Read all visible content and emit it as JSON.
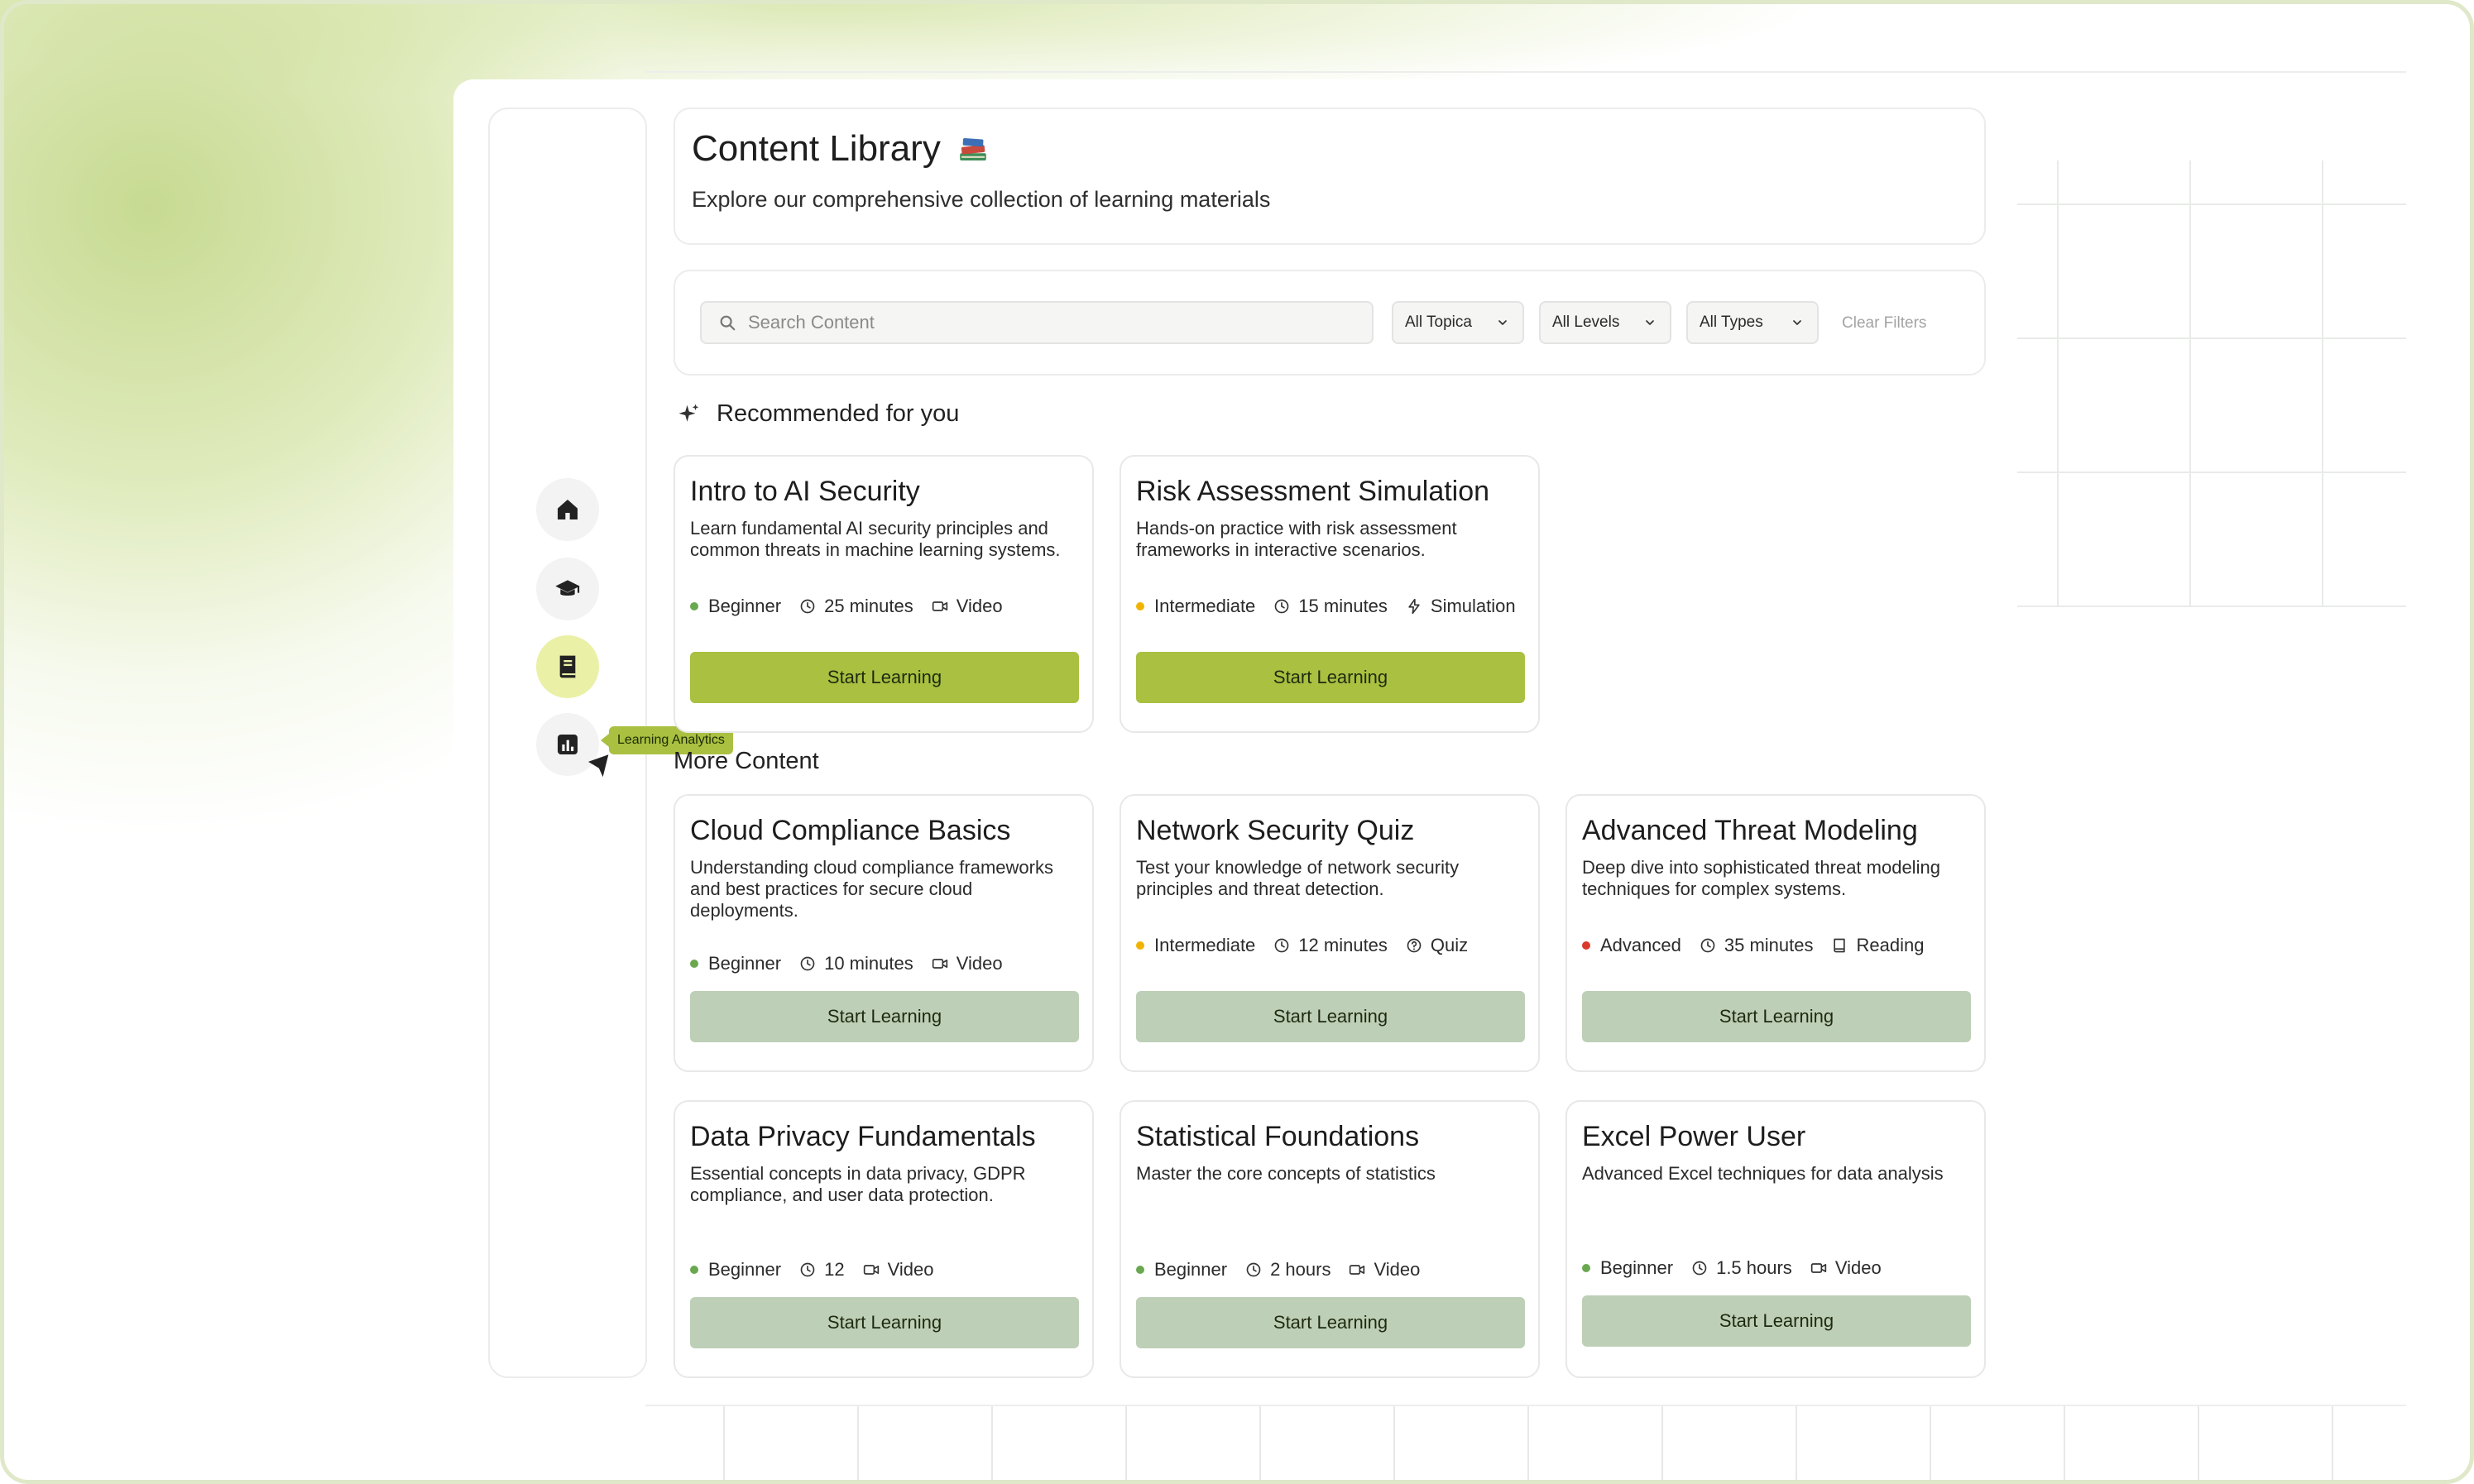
{
  "header": {
    "title": "Content Library",
    "subtitle": "Explore our comprehensive collection of learning materials"
  },
  "sidebar": {
    "items": [
      {
        "name": "home",
        "icon": "home-icon",
        "active": false
      },
      {
        "name": "courses",
        "icon": "graduation-cap-icon",
        "active": false
      },
      {
        "name": "library",
        "icon": "book-icon",
        "active": true
      },
      {
        "name": "analytics",
        "icon": "bar-chart-icon",
        "active": false
      }
    ],
    "tooltip": "Learning Analytics"
  },
  "filters": {
    "search_placeholder": "Search Content",
    "topics": "All Topica",
    "levels": "All Levels",
    "types": "All Types",
    "clear": "Clear Filters"
  },
  "sections": {
    "recommended": "Recommended for you",
    "more": "More Content"
  },
  "colors": {
    "accent": "#a9c040",
    "accent_soft": "#eaf0a6",
    "button_muted": "#bdcfb6",
    "beginner": "#6aa84f",
    "intermediate": "#f0b400",
    "advanced": "#d93a2b"
  },
  "recommended": [
    {
      "title": "Intro to AI Security",
      "description": "Learn fundamental AI security principles and common threats in machine learning systems.",
      "level": "Beginner",
      "duration": "25 minutes",
      "type": "Video",
      "type_icon": "video-icon",
      "button": "Start Learning"
    },
    {
      "title": "Risk Assessment Simulation",
      "description": "Hands-on practice with risk assessment frameworks in interactive scenarios.",
      "level": "Intermediate",
      "duration": "15 minutes",
      "type": "Simulation",
      "type_icon": "lightning-icon",
      "button": "Start Learning"
    }
  ],
  "more": [
    {
      "title": "Cloud Compliance Basics",
      "description": "Understanding cloud compliance frameworks and best practices for secure cloud deployments.",
      "level": "Beginner",
      "duration": "10 minutes",
      "type": "Video",
      "type_icon": "video-icon",
      "button": "Start Learning"
    },
    {
      "title": "Network Security Quiz",
      "description": "Test your knowledge of network security principles and threat detection.",
      "level": "Intermediate",
      "duration": "12 minutes",
      "type": "Quiz",
      "type_icon": "question-icon",
      "button": "Start Learning"
    },
    {
      "title": "Advanced Threat Modeling",
      "description": "Deep dive into sophisticated threat modeling techniques for complex systems.",
      "level": "Advanced",
      "duration": "35 minutes",
      "type": "Reading",
      "type_icon": "book-icon",
      "button": "Start Learning"
    },
    {
      "title": "Data Privacy Fundamentals",
      "description": "Essential concepts in data privacy, GDPR compliance, and user data protection.",
      "level": "Beginner",
      "duration": "12",
      "type": "Video",
      "type_icon": "video-icon",
      "button": "Start Learning"
    },
    {
      "title": "Statistical Foundations",
      "description": "Master the core concepts of statistics",
      "level": "Beginner",
      "duration": "2 hours",
      "type": "Video",
      "type_icon": "video-icon",
      "button": "Start Learning"
    },
    {
      "title": "Excel Power User",
      "description": "Advanced Excel techniques for data analysis",
      "level": "Beginner",
      "duration": "1.5 hours",
      "type": "Video",
      "type_icon": "video-icon",
      "button": "Start Learning"
    }
  ]
}
